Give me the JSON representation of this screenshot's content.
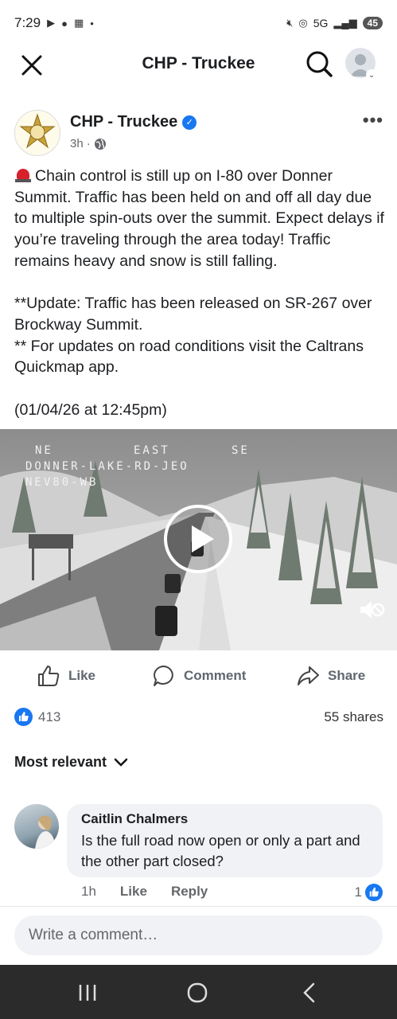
{
  "status_bar": {
    "time": "7:29",
    "network": "5G",
    "battery": "45"
  },
  "header": {
    "title": "CHP - Truckee"
  },
  "post": {
    "page_name": "CHP - Truckee",
    "time_ago": "3h",
    "time_separator": "·",
    "paragraphs": [
      "Chain control is still up on  I-80 over Donner Summit. Traffic has been held on and off all day due to multiple spin-outs over the summit. Expect delays if you’re traveling through the area today! Traffic remains heavy and snow is still falling.",
      "**Update: Traffic has been released on SR-267 over Brockway Summit.",
      "** For updates on road conditions visit the Caltrans Quickmap app.",
      "(01/04/26 at 12:45pm)"
    ],
    "video_overlay": {
      "line1_ne": "NE",
      "line1_east": "EAST",
      "line1_se": "SE",
      "line2": "DONNER-LAKE-RD-JEO",
      "line3": "NEV80-WB"
    }
  },
  "actions": {
    "like": "Like",
    "comment": "Comment",
    "share": "Share"
  },
  "reactions": {
    "count": "413",
    "shares": "55 shares"
  },
  "comments_section": {
    "sort_label": "Most relevant",
    "comments": [
      {
        "author": "Caitlin Chalmers",
        "text": "Is the full road now open or only a part and the other part closed?",
        "time": "1h",
        "like_label": "Like",
        "reply_label": "Reply",
        "likes": "1"
      }
    ],
    "write_placeholder": "Write a comment…"
  },
  "colors": {
    "brand_blue": "#1877f2",
    "text_primary": "#1c1e21",
    "text_secondary": "#65676b",
    "bubble_bg": "#f0f2f5",
    "nav_bar": "#2b2b2b"
  }
}
